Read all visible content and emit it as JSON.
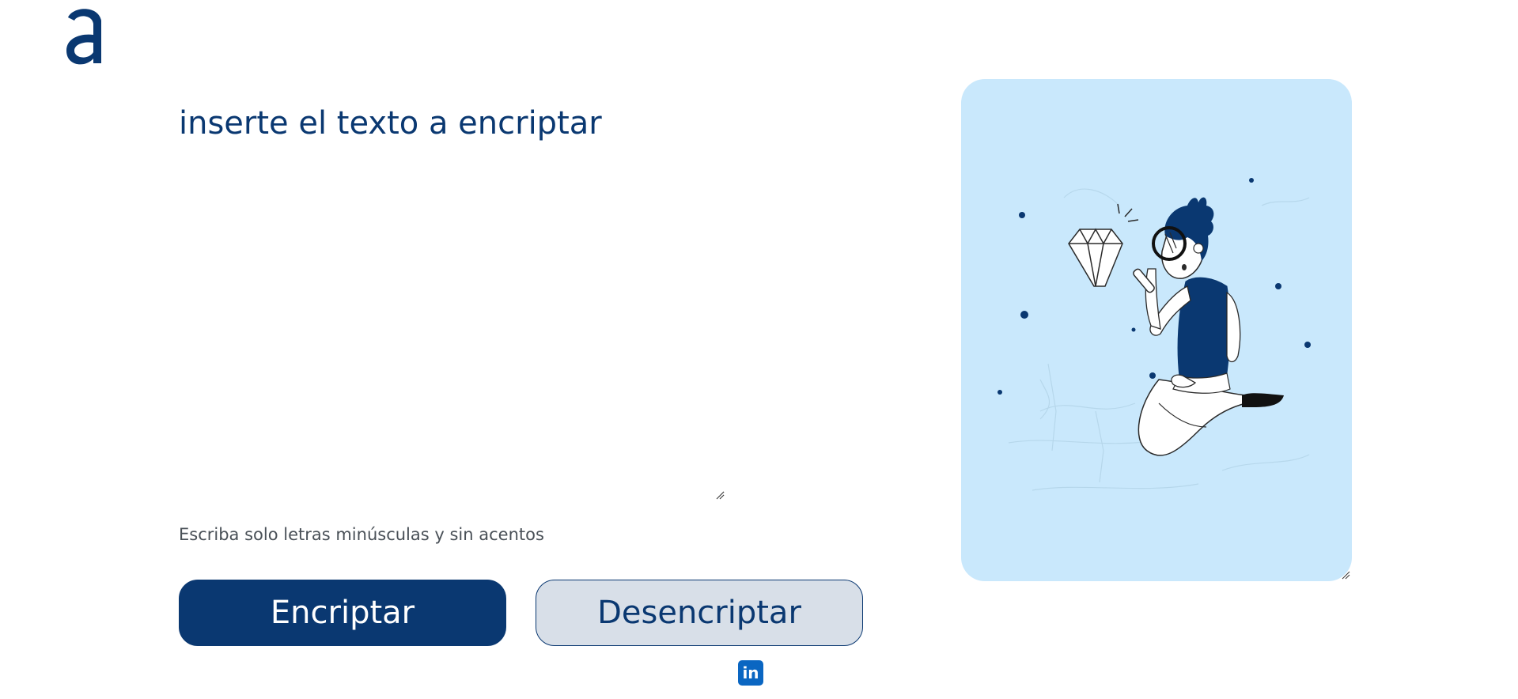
{
  "brand": {
    "logo_letter": "a",
    "logo_color": "#0a3871"
  },
  "input": {
    "placeholder": "inserte el texto a encriptar",
    "value": ""
  },
  "hint": {
    "text": "Escriba solo letras minúsculas y sin acentos",
    "icon": "info-icon"
  },
  "buttons": {
    "encrypt_label": "Encriptar",
    "decrypt_label": "Desencriptar"
  },
  "footer": {
    "linkedin_label": "in",
    "linkedin_icon": "linkedin-icon"
  },
  "output": {
    "illustration": "person-with-magnifier-and-diamond",
    "background_color": "#c9e8fc"
  },
  "colors": {
    "primary": "#0a3871",
    "secondary_bg": "#d8dfe8",
    "panel_bg": "#c9e8fc",
    "linkedin": "#0a66c2"
  }
}
